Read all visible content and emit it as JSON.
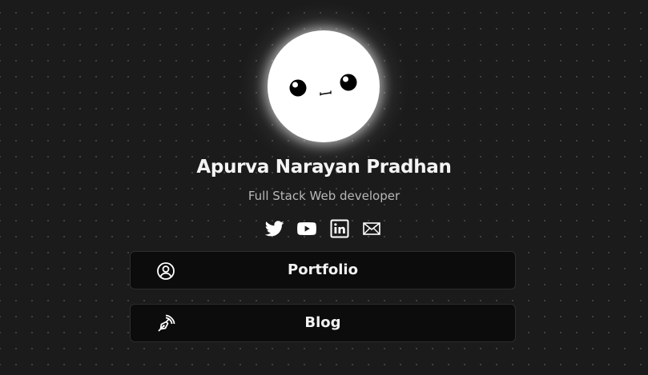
{
  "profile": {
    "name": "Apurva Narayan Pradhan",
    "subtitle": "Full Stack Web developer",
    "avatar_icon": "cute-face-avatar"
  },
  "socials": [
    {
      "icon": "twitter-icon"
    },
    {
      "icon": "youtube-icon"
    },
    {
      "icon": "linkedin-icon"
    },
    {
      "icon": "mail-icon"
    }
  ],
  "links": [
    {
      "label": "Portfolio",
      "icon": "user-circle-icon"
    },
    {
      "label": "Blog",
      "icon": "pen-nib-icon"
    }
  ],
  "colors": {
    "background": "#1b1b1b",
    "card_background": "#0c0c0d",
    "text": "#ffffff",
    "subtitle": "#b8b8b8"
  }
}
